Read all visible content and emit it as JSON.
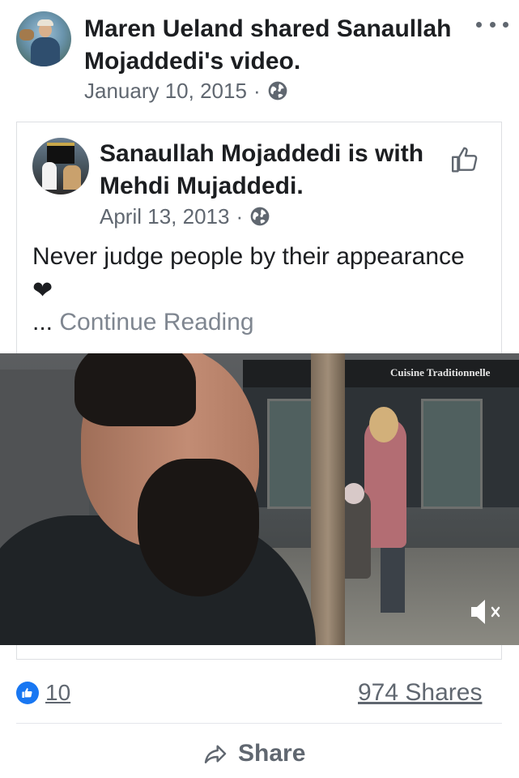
{
  "share_header": {
    "title": "Maren Ueland shared Sanaullah Mojaddedi's video.",
    "date": "January 10, 2015",
    "separator": "·",
    "privacy_icon": "globe-icon",
    "more_icon": "more-options-icon"
  },
  "original_post": {
    "title": "Sanaullah Mojaddedi is with Mehdi Mujaddedi.",
    "date": "April 13, 2013",
    "separator": "·",
    "privacy_icon": "globe-icon",
    "like_icon": "thumbs-up-icon",
    "text": "Never judge people by their appearance ❤",
    "ellipsis": "...",
    "continue_label": "Continue Reading"
  },
  "video": {
    "store_sign": "Cuisine Traditionnelle",
    "mute_icon": "speaker-muted-icon"
  },
  "footer": {
    "reaction_icon": "like-badge-icon",
    "reaction_count": "10",
    "shares": "974 Shares",
    "share_icon": "share-arrow-icon",
    "share_label": "Share"
  },
  "colors": {
    "primary_text": "#1c1e21",
    "secondary_text": "#606770",
    "link_gray": "#7f8690",
    "like_blue": "#1877f2",
    "border": "#dddfe2"
  }
}
